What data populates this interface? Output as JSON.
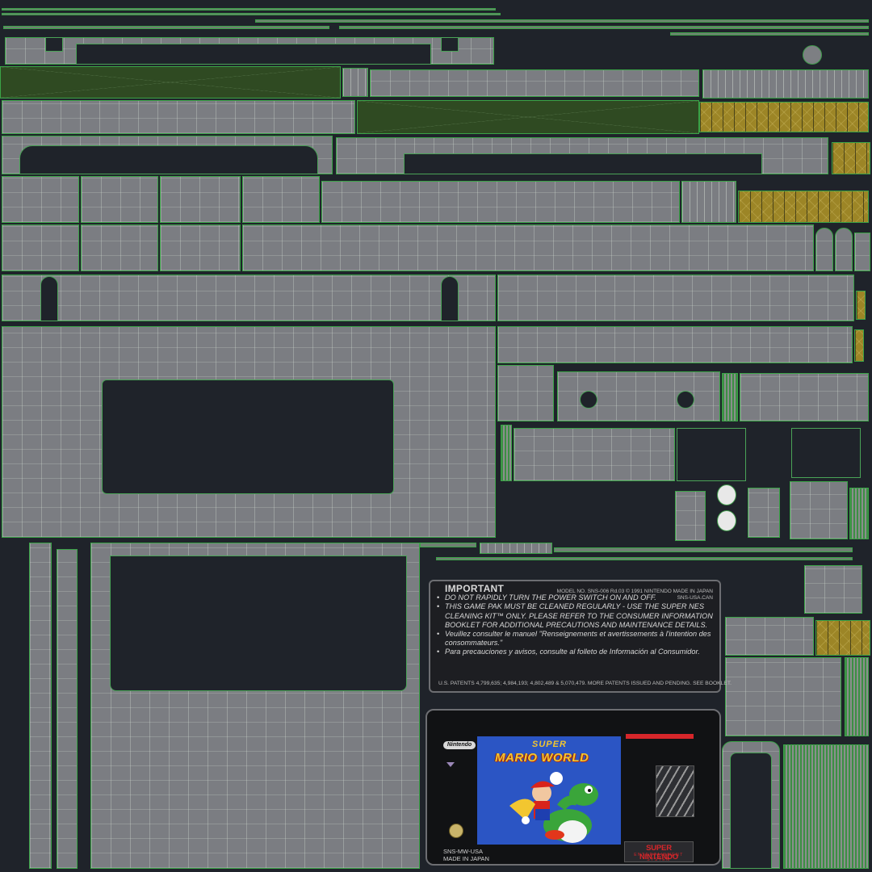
{
  "label": {
    "title": "IMPORTANT",
    "model_line1": "MODEL NO. SNS-006  Rd.03  © 1991 NINTENDO  MADE IN JAPAN",
    "model_line2": "SNS-USA.CAN",
    "bullets": [
      "DO NOT RAPIDLY TURN THE POWER SWITCH ON AND OFF.",
      "THIS GAME PAK MUST BE CLEANED REGULARLY - USE THE SUPER NES CLEANING KIT™ ONLY. PLEASE REFER TO THE CONSUMER INFORMATION BOOKLET FOR ADDITIONAL PRECAUTIONS AND MAINTENANCE DETAILS.",
      "Veuillez consulter le manuel \"Renseignements et avertissements à l'intention des consommateurs.\"",
      "Para precauciones y avisos, consulte al folleto de Información al Consumidor."
    ],
    "patents": "U.S. PATENTS 4,799,635; 4,984,193; 4,802,489 & 5,070,479. MORE PATENTS ISSUED AND PENDING. SEE BOOKLET."
  },
  "cartridge": {
    "brand": "Nintendo",
    "game_super": "SUPER",
    "game_title": "MARIO WORLD",
    "code": "SNS-MW-USA",
    "made_in": "MADE IN JAPAN",
    "console_logo": "SUPER NINTENDO",
    "console_logo_sub": "ENTERTAINMENT SYSTEM"
  }
}
